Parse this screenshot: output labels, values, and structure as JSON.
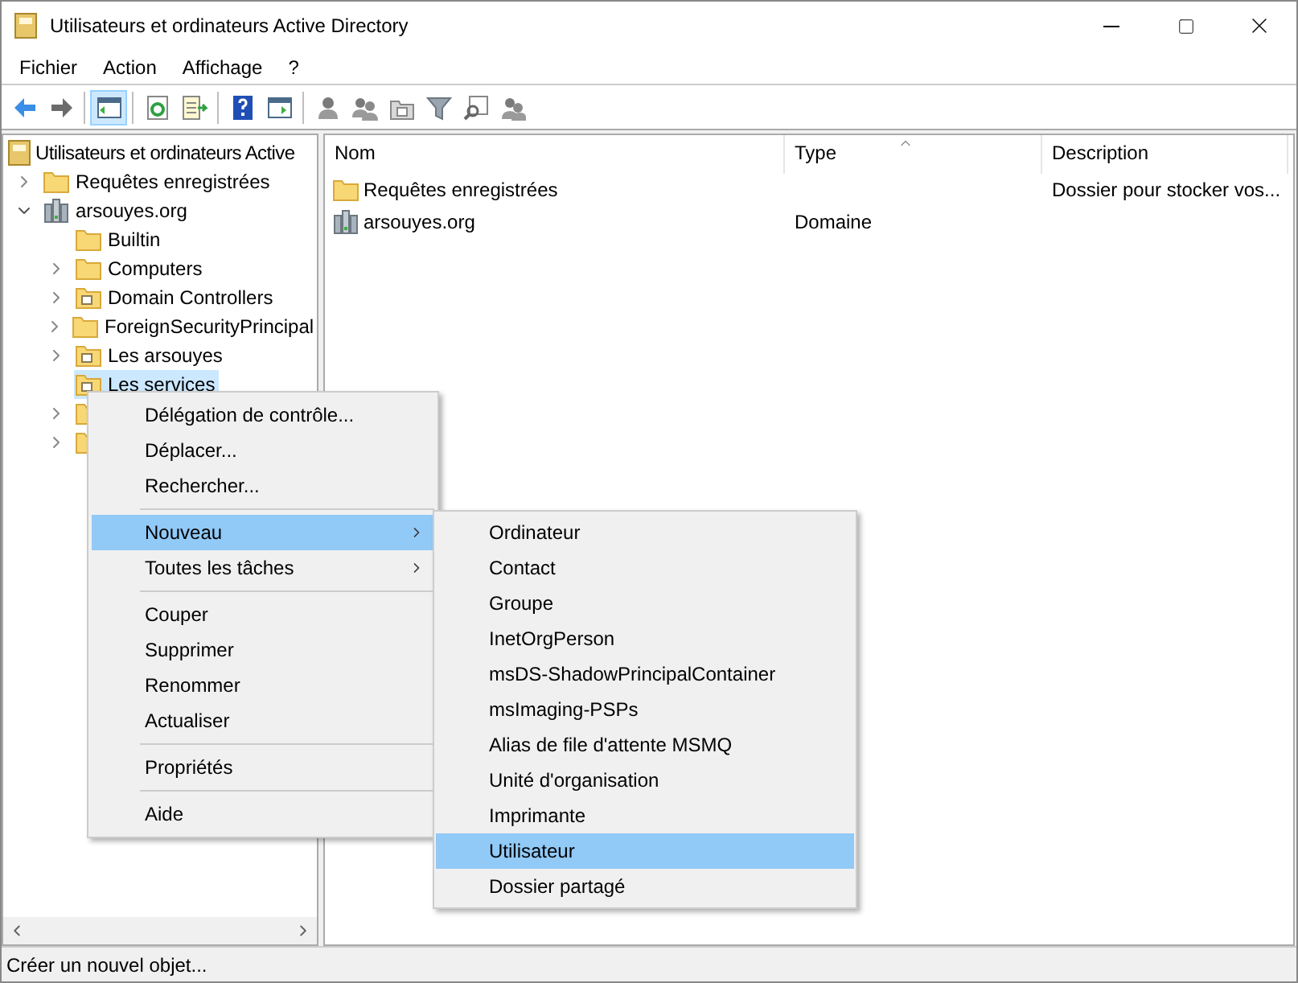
{
  "window": {
    "title": "Utilisateurs et ordinateurs Active Directory"
  },
  "menu_bar": [
    "Fichier",
    "Action",
    "Affichage",
    "?"
  ],
  "toolbar": [
    [
      {
        "kind": "back",
        "pressed": false
      },
      {
        "kind": "forward",
        "pressed": false
      }
    ],
    [
      {
        "kind": "tree",
        "pressed": true
      }
    ],
    [
      {
        "kind": "refresh",
        "pressed": false
      },
      {
        "kind": "export",
        "pressed": false
      }
    ],
    [
      {
        "kind": "help",
        "pressed": false
      },
      {
        "kind": "panel",
        "pressed": false
      }
    ],
    [
      {
        "kind": "user",
        "pressed": false
      },
      {
        "kind": "group",
        "pressed": false
      },
      {
        "kind": "ou",
        "pressed": false
      },
      {
        "kind": "filter",
        "pressed": false
      },
      {
        "kind": "find",
        "pressed": false
      },
      {
        "kind": "users",
        "pressed": false
      }
    ]
  ],
  "tree": {
    "label": "Utilisateurs et ordinateurs Active",
    "kind": "snapin",
    "children": [
      {
        "label": "Requêtes enregistrées",
        "kind": "folder",
        "expanded": false,
        "selected": false
      },
      {
        "label": "arsouyes.org",
        "kind": "domain",
        "expanded": true,
        "selected": false,
        "children": [
          {
            "label": "Builtin",
            "kind": "folder",
            "selected": false
          },
          {
            "label": "Computers",
            "kind": "folder",
            "expanded": false,
            "selected": false
          },
          {
            "label": "Domain Controllers",
            "kind": "ou",
            "expanded": false,
            "selected": false
          },
          {
            "label": "ForeignSecurityPrincipal",
            "kind": "folder",
            "expanded": false,
            "selected": false
          },
          {
            "label": "Les arsouyes",
            "kind": "ou",
            "expanded": false,
            "selected": false
          },
          {
            "label": "Les services",
            "kind": "ou",
            "selected": true
          },
          {
            "kind": "folder",
            "expanded": false,
            "selected": false
          },
          {
            "kind": "folder",
            "expanded": false,
            "selected": false
          }
        ]
      }
    ]
  },
  "list": {
    "columns": [
      {
        "label": "Nom",
        "sorted": false
      },
      {
        "label": "Type",
        "sorted": true
      },
      {
        "label": "Description",
        "sorted": false
      }
    ],
    "rows": [
      {
        "kind": "folder",
        "name": "Requêtes enregistrées",
        "description": "Dossier pour stocker vos..."
      },
      {
        "kind": "domain",
        "name": "arsouyes.org",
        "type": "Domaine"
      }
    ]
  },
  "context_menu": [
    {
      "kind": "item",
      "label": "Délégation de contrôle...",
      "selected": false
    },
    {
      "kind": "item",
      "label": "Déplacer...",
      "selected": false
    },
    {
      "kind": "item",
      "label": "Rechercher...",
      "selected": false
    },
    {
      "kind": "separator"
    },
    {
      "kind": "submenu",
      "label": "Nouveau",
      "selected": true
    },
    {
      "kind": "submenu",
      "label": "Toutes les tâches",
      "selected": false
    },
    {
      "kind": "separator"
    },
    {
      "kind": "item",
      "label": "Couper",
      "selected": false
    },
    {
      "kind": "item",
      "label": "Supprimer",
      "selected": false
    },
    {
      "kind": "item",
      "label": "Renommer",
      "selected": false
    },
    {
      "kind": "item",
      "label": "Actualiser",
      "selected": false
    },
    {
      "kind": "separator"
    },
    {
      "kind": "item",
      "label": "Propriétés",
      "selected": false
    },
    {
      "kind": "separator"
    },
    {
      "kind": "item",
      "label": "Aide",
      "selected": false
    }
  ],
  "submenu": [
    {
      "label": "Ordinateur",
      "selected": false
    },
    {
      "label": "Contact",
      "selected": false
    },
    {
      "label": "Groupe",
      "selected": false
    },
    {
      "label": "InetOrgPerson",
      "selected": false
    },
    {
      "label": "msDS-ShadowPrincipalContainer",
      "selected": false
    },
    {
      "label": "msImaging-PSPs",
      "selected": false
    },
    {
      "label": "Alias de file d'attente MSMQ",
      "selected": false
    },
    {
      "label": "Unité d'organisation",
      "selected": false
    },
    {
      "label": "Imprimante",
      "selected": false
    },
    {
      "label": "Utilisateur",
      "selected": true
    },
    {
      "label": "Dossier partagé",
      "selected": false
    }
  ],
  "status_bar": "Créer un nouvel objet..."
}
